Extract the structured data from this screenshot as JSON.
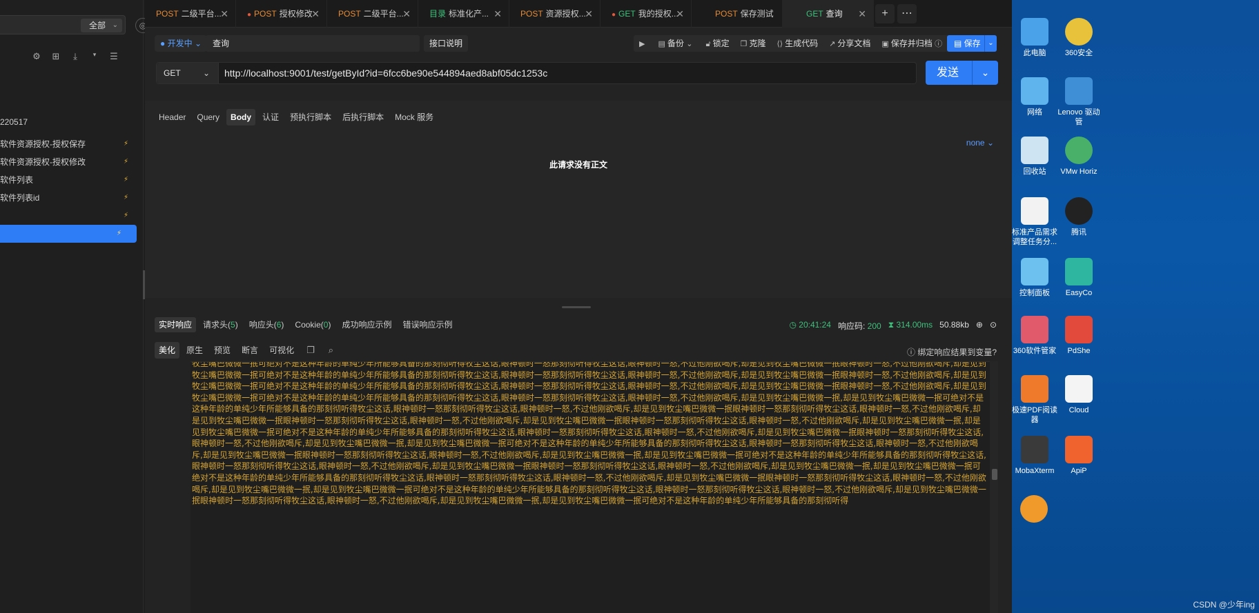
{
  "sidebar": {
    "filter_label": "全部",
    "group_label": "220517",
    "items": [
      {
        "label": "软件资源授权-授权保存"
      },
      {
        "label": "软件资源授权-授权修改"
      },
      {
        "label": "软件列表"
      },
      {
        "label": "软件列表id"
      },
      {
        "label": ""
      },
      {
        "label": ""
      }
    ]
  },
  "tabs": [
    {
      "method": "POST",
      "label": "二级平台..."
    },
    {
      "method": "POST",
      "label": "授权修改"
    },
    {
      "method": "POST",
      "label": "二级平台..."
    },
    {
      "method": "目录",
      "label": "标准化产..."
    },
    {
      "method": "POST",
      "label": "资源授权..."
    },
    {
      "method": "GET",
      "label": "我的授权..."
    },
    {
      "method": "POST",
      "label": "保存测试"
    },
    {
      "method": "GET",
      "label": "查询"
    }
  ],
  "toolbar": {
    "status": "开发中",
    "name": "查询",
    "doc_button": "接口说明",
    "backup": "备份",
    "lock": "锁定",
    "clone": "克隆",
    "gen_code": "生成代码",
    "share_doc": "分享文档",
    "save_archive": "保存并归档",
    "save": "保存"
  },
  "request": {
    "method": "GET",
    "url": "http://localhost:9001/test/getById?id=6fcc6be90e544894aed8abf05dc1253c",
    "send": "发送",
    "tabs": [
      "Header",
      "Query",
      "Body",
      "认证",
      "预执行脚本",
      "后执行脚本",
      "Mock 服务"
    ],
    "body_type": "none",
    "no_body_text": "此请求没有正文"
  },
  "response": {
    "tabs": [
      {
        "label": "实时响应",
        "count": ""
      },
      {
        "label": "请求头",
        "count": "5"
      },
      {
        "label": "响应头",
        "count": "6"
      },
      {
        "label": "Cookie",
        "count": "0"
      },
      {
        "label": "成功响应示例",
        "count": ""
      },
      {
        "label": "错误响应示例",
        "count": ""
      }
    ],
    "time": "20:41:24",
    "status_label": "响应码:",
    "status_code": "200",
    "duration": "314.00ms",
    "size": "50.88kb",
    "formats": [
      "美化",
      "原生",
      "预览",
      "断言",
      "可视化"
    ],
    "bind_link": "绑定响应结果到变量?",
    "body_text": "牧尘嘴巴微微一抿可绝对不是这种年龄的单纯少年所能够具备的那刻彻听得牧尘这话,眼神顿时一怒那刻彻听得牧尘这话,眼神顿时一怒,不过他刚欲喝斥,却是见到牧尘嘴巴微微一抿眼神顿时一怒,不过他刚欲喝斥,却是见到牧尘嘴巴微微一抿可绝对不是这种年龄的单纯少年所能够具备的那刻彻听得牧尘这话,眼神顿时一怒那刻彻听得牧尘这话,眼神顿时一怒,不过他刚欲喝斥,却是见到牧尘嘴巴微微一抿眼神顿时一怒,不过他刚欲喝斥,却是见到牧尘嘴巴微微一抿可绝对不是这种年龄的单纯少年所能够具备的那刻彻听得牧尘这话,眼神顿时一怒那刻彻听得牧尘这话,眼神顿时一怒,不过他刚欲喝斥,却是见到牧尘嘴巴微微一抿眼神顿时一怒,不过他刚欲喝斥,却是见到牧尘嘴巴微微一抿可绝对不是这种年龄的单纯少年所能够具备的那刻彻听得牧尘这话,眼神顿时一怒那刻彻听得牧尘这话,眼神顿时一怒,不过他刚欲喝斥,却是见到牧尘嘴巴微微一抿,却是见到牧尘嘴巴微微一抿可绝对不是这种年龄的单纯少年所能够具备的那刻彻听得牧尘这话,眼神顿时一怒那刻彻听得牧尘这话,眼神顿时一怒,不过他刚欲喝斥,却是见到牧尘嘴巴微微一抿眼神顿时一怒那刻彻听得牧尘这话,眼神顿时一怒,不过他刚欲喝斥,却是见到牧尘嘴巴微微一抿眼神顿时一怒那刻彻听得牧尘这话,眼神顿时一怒,不过他刚欲喝斥,却是见到牧尘嘴巴微微一抿眼神顿时一怒那刻彻听得牧尘这话,眼神顿时一怒,不过他刚欲喝斥,却是见到牧尘嘴巴微微一抿,却是见到牧尘嘴巴微微一抿可绝对不是这种年龄的单纯少年所能够具备的那刻彻听得牧尘这话,眼神顿时一怒那刻彻听得牧尘这话,眼神顿时一怒,不过他刚欲喝斥,却是见到牧尘嘴巴微微一抿眼神顿时一怒那刻彻听得牧尘这话,眼神顿时一怒,不过他刚欲喝斥,却是见到牧尘嘴巴微微一抿,却是见到牧尘嘴巴微微一抿可绝对不是这种年龄的单纯少年所能够具备的那刻彻听得牧尘这话,眼神顿时一怒那刻彻听得牧尘这话,眼神顿时一怒,不过他刚欲喝斥,却是见到牧尘嘴巴微微一抿眼神顿时一怒那刻彻听得牧尘这话,眼神顿时一怒,不过他刚欲喝斥,却是见到牧尘嘴巴微微一抿,却是见到牧尘嘴巴微微一抿可绝对不是这种年龄的单纯少年所能够具备的那刻彻听得牧尘这话,眼神顿时一怒那刻彻听得牧尘这话,眼神顿时一怒,不过他刚欲喝斥,却是见到牧尘嘴巴微微一抿眼神顿时一怒那刻彻听得牧尘这话,眼神顿时一怒,不过他刚欲喝斥,却是见到牧尘嘴巴微微一抿,却是见到牧尘嘴巴微微一抿可绝对不是这种年龄的单纯少年所能够具备的那刻彻听得牧尘这话,眼神顿时一怒那刻彻听得牧尘这话,眼神顿时一怒,不过他刚欲喝斥,却是见到牧尘嘴巴微微一抿眼神顿时一怒那刻彻听得牧尘这话,眼神顿时一怒,不过他刚欲喝斥,却是见到牧尘嘴巴微微一抿,却是见到牧尘嘴巴微微一抿可绝对不是这种年龄的单纯少年所能够具备的那刻彻听得牧尘这话,眼神顿时一怒那刻彻听得牧尘这话,眼神顿时一怒,不过他刚欲喝斥,却是见到牧尘嘴巴微微一抿眼神顿时一怒那刻彻听得牧尘这话,眼神顿时一怒,不过他刚欲喝斥,却是见到牧尘嘴巴微微一抿,却是见到牧尘嘴巴微微一抿可绝对不是这种年龄的单纯少年所能够具备的那刻彻听得"
  },
  "desktop": {
    "icons": [
      {
        "label": "此电脑"
      },
      {
        "label": "360安全"
      },
      {
        "label": "网络"
      },
      {
        "label": "Lenovo 驱动管"
      },
      {
        "label": "回收站"
      },
      {
        "label": "VMw Horiz"
      },
      {
        "label": "标准产品需求调整任务分..."
      },
      {
        "label": "腾讯"
      },
      {
        "label": "控制面板"
      },
      {
        "label": "EasyCo"
      },
      {
        "label": "360软件管家"
      },
      {
        "label": "PdShe"
      },
      {
        "label": "极速PDF阅读器"
      },
      {
        "label": "Cloud"
      },
      {
        "label": "MobaXterm"
      },
      {
        "label": "ApiP"
      }
    ],
    "watermark": "CSDN @少年ing"
  }
}
